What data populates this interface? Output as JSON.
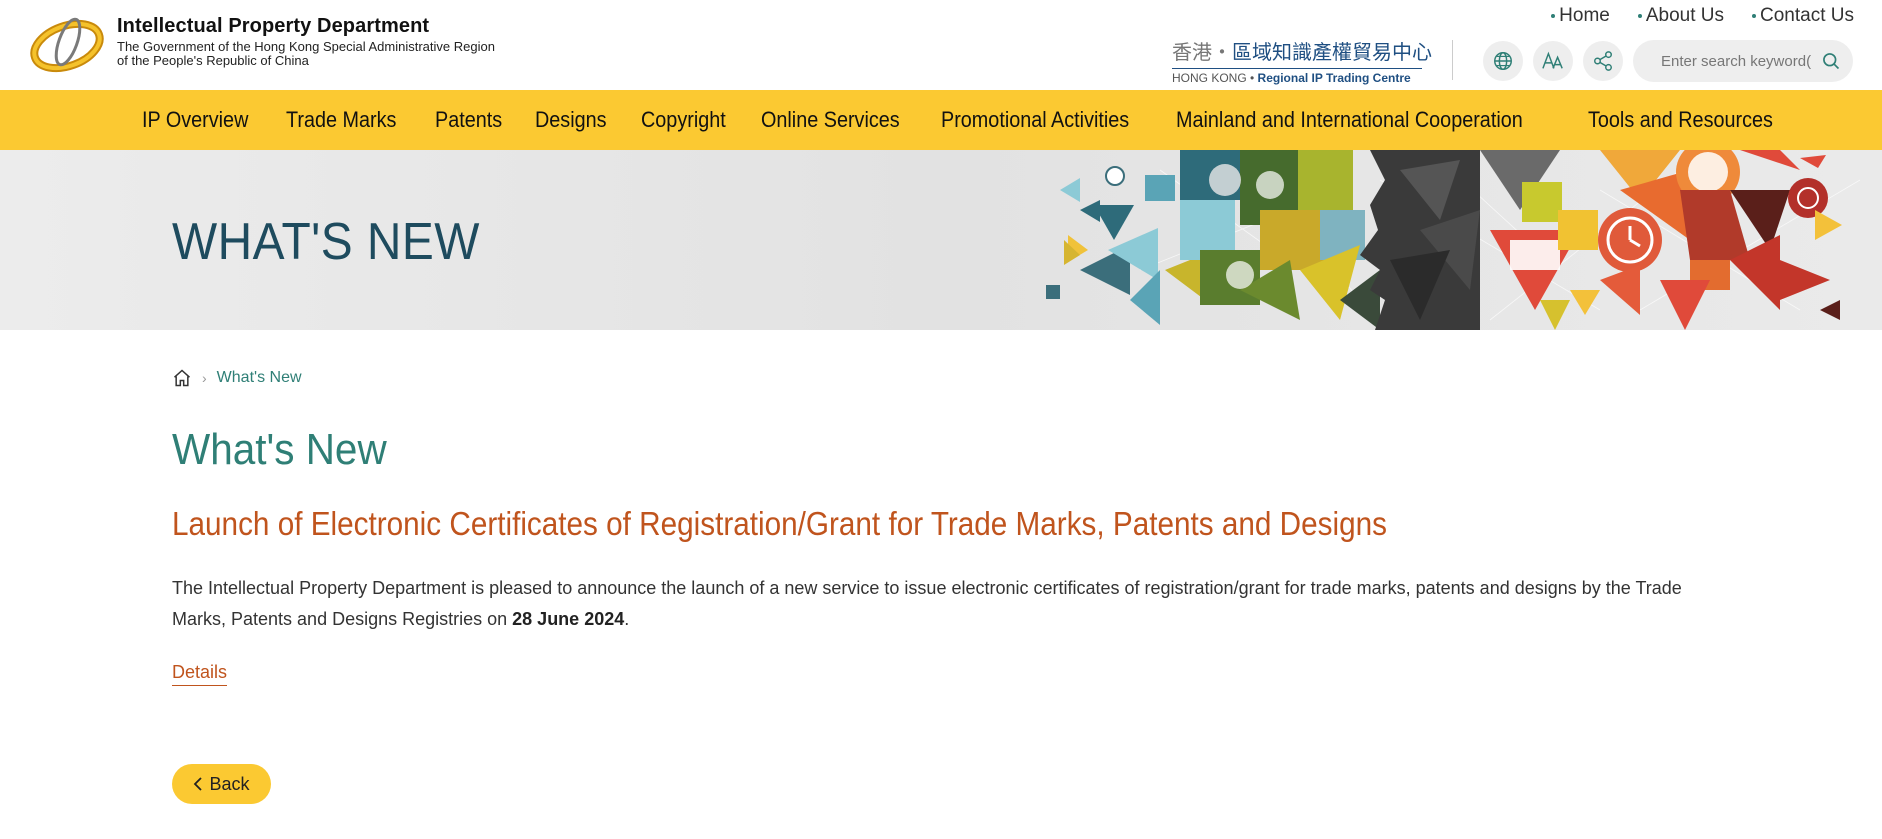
{
  "header": {
    "dept_name": "Intellectual Property Department",
    "gov_line1": "The Government of the Hong Kong Special Administrative Region",
    "gov_line2": "of the People's Republic of China",
    "top_links": [
      "Home",
      "About Us",
      "Contact Us"
    ],
    "ip_trading": {
      "cn_prefix": "香港・",
      "cn_main": "區域知識產權貿易中心",
      "en_prefix": "HONG KONG • ",
      "en_main": "Regional IP Trading Centre"
    },
    "tools": [
      {
        "icon": "globe-icon"
      },
      {
        "icon": "font-size-icon"
      },
      {
        "icon": "share-icon"
      }
    ],
    "search": {
      "placeholder": "Enter search keyword("
    }
  },
  "nav": {
    "items": [
      "IP Overview",
      "Trade Marks",
      "Patents",
      "Designs",
      "Copyright",
      "Online Services",
      "Promotional Activities",
      "Mainland and International Cooperation",
      "Tools and Resources"
    ]
  },
  "banner": {
    "title": "WHAT'S NEW"
  },
  "breadcrumb": {
    "current": "What's New"
  },
  "main": {
    "page_title": "What's New",
    "news_title": "Launch of Electronic Certificates of Registration/Grant for Trade Marks, Patents and Designs",
    "body_before": "The Intellectual Property Department is pleased to announce the launch of a new service to issue electronic certificates of registration/grant for trade marks, patents and designs by the Trade Marks, Patents and Designs Registries on ",
    "body_date": "28 June 2024",
    "body_after": ".",
    "details_label": "Details",
    "back_label": "Back"
  },
  "colors": {
    "accent_yellow": "#fbc932",
    "teal": "#2f7f76",
    "orange": "#c0541d",
    "banner_title": "#1e4b5e"
  }
}
